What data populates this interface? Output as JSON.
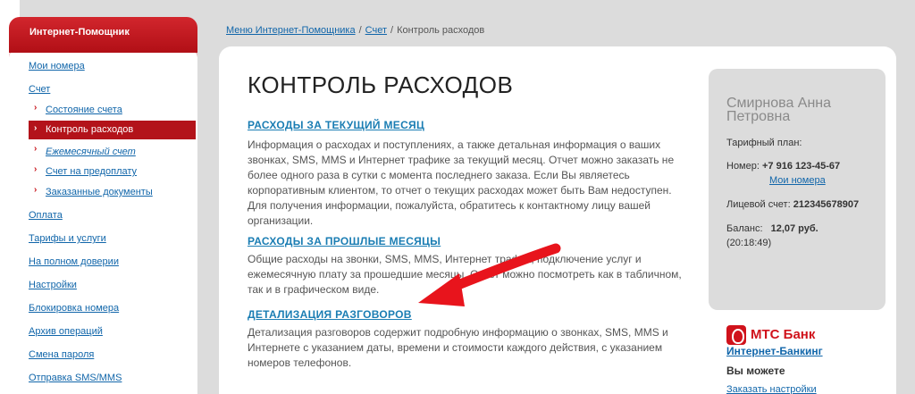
{
  "sidebar": {
    "header": "Интернет-Помощник",
    "items": [
      {
        "label": "Мои номера"
      },
      {
        "label": "Счет"
      },
      {
        "label": "Состояние счета"
      },
      {
        "label": "Контроль расходов"
      },
      {
        "label": "Ежемесячный счет"
      },
      {
        "label": "Счет на предоплату"
      },
      {
        "label": "Заказанные документы"
      },
      {
        "label": "Оплата"
      },
      {
        "label": "Тарифы и услуги"
      },
      {
        "label": "На полном доверии"
      },
      {
        "label": "Настройки"
      },
      {
        "label": "Блокировка номера"
      },
      {
        "label": "Архив операций"
      },
      {
        "label": "Смена пароля"
      },
      {
        "label": "Отправка SMS/MMS"
      }
    ]
  },
  "breadcrumb": {
    "items": [
      "Меню Интернет-Помощника",
      "Счет"
    ],
    "current": "Контроль расходов",
    "separator": "/"
  },
  "main": {
    "title": "КОНТРОЛЬ РАСХОДОВ",
    "sections": [
      {
        "link": "РАСХОДЫ ЗА ТЕКУЩИЙ МЕСЯЦ",
        "text": "Информация о расходах и поступлениях, а также детальная информация о ваших звонках, SMS, MMS и Интернет трафике за текущий месяц. Отчет можно заказать не более одного раза в сутки с момента последнего заказа. Если Вы являетесь корпоративным клиентом, то отчет о текущих расходах может быть Вам недоступен. Для получения информации, пожалуйста, обратитесь к контактному лицу вашей организации."
      },
      {
        "link": "РАСХОДЫ ЗА ПРОШЛЫЕ МЕСЯЦЫ",
        "text": "Общие расходы на звонки, SMS, MMS, Интернет трафик, подключение услуг и ежемесячную плату за прошедшие месяцы. Отчет можно посмотреть как в табличном, так и в графическом виде."
      },
      {
        "link": "ДЕТАЛИЗАЦИЯ РАЗГОВОРОВ",
        "text": "Детализация разговоров содержит подробную информацию о звонках, SMS, MMS и Интернете с указанием даты, времени и стоимости каждого действия, с указанием номеров телефонов."
      }
    ]
  },
  "profile": {
    "name": "Смирнова Анна Петровна",
    "tariff_label": "Тарифный план:",
    "number_label": "Номер:",
    "number_value": "+7 916 123-45-67",
    "my_numbers_link": "Мои номера",
    "account_label": "Лицевой счет:",
    "account_value": "212345678907",
    "balance_label": "Баланс:",
    "balance_value": "12,07 руб.",
    "balance_time": "(20:18:49)"
  },
  "bank": {
    "title": "МТС Банк",
    "subtitle": "Интернет-Банкинг",
    "can_label": "Вы можете",
    "settings_link": "Заказать настройки"
  },
  "colors": {
    "brand_red": "#c8151c",
    "link_blue": "#1166aa",
    "arrow_red": "#e8141c"
  }
}
